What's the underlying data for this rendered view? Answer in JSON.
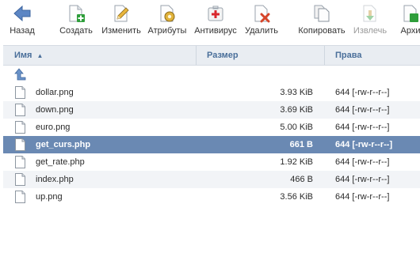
{
  "toolbar": {
    "back": "Назад",
    "create": "Создать",
    "edit": "Изменить",
    "attributes": "Атрибуты",
    "antivirus": "Антивирус",
    "delete": "Удалить",
    "copy": "Копировать",
    "extract": "Извлечь",
    "archive": "Архи"
  },
  "columns": {
    "name": "Имя",
    "sort_indicator": "▲",
    "size": "Размер",
    "rights": "Права"
  },
  "files": [
    {
      "name": "dollar.png",
      "size": "3.93 KiB",
      "rights": "644 [-rw-r--r--]"
    },
    {
      "name": "down.png",
      "size": "3.69 KiB",
      "rights": "644 [-rw-r--r--]"
    },
    {
      "name": "euro.png",
      "size": "5.00 KiB",
      "rights": "644 [-rw-r--r--]"
    },
    {
      "name": "get_curs.php",
      "size": "661 B",
      "rights": "644 [-rw-r--r--]"
    },
    {
      "name": "get_rate.php",
      "size": "1.92 KiB",
      "rights": "644 [-rw-r--r--]"
    },
    {
      "name": "index.php",
      "size": "466 B",
      "rights": "644 [-rw-r--r--]"
    },
    {
      "name": "up.png",
      "size": "3.56 KiB",
      "rights": "644 [-rw-r--r--]"
    }
  ],
  "selected_file": "get_curs.php",
  "colors": {
    "header_bg": "#e9edf2",
    "header_text": "#4a6f9a",
    "selection": "#6a89b3",
    "alt_row": "#f2f4f7"
  }
}
